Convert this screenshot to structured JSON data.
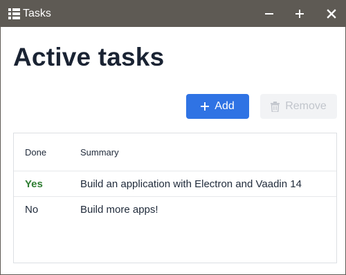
{
  "window": {
    "title": "Tasks",
    "icon": "list-icon",
    "controls": [
      "minimize-icon",
      "maximize-icon",
      "close-icon"
    ]
  },
  "page": {
    "title": "Active tasks"
  },
  "toolbar": {
    "add_label": "Add",
    "add_icon": "plus-icon",
    "remove_label": "Remove",
    "remove_icon": "trash-icon",
    "remove_disabled": true
  },
  "grid": {
    "columns": [
      "Done",
      "Summary"
    ],
    "rows": [
      {
        "done": "Yes",
        "summary": "Build an application with Electron and Vaadin 14"
      },
      {
        "done": "No",
        "summary": "Build more apps!"
      }
    ]
  },
  "colors": {
    "titlebar": "#5e5a54",
    "accent": "#2f73e4",
    "done_yes": "#2e7d32",
    "disabled_bg": "#f2f3f5",
    "disabled_text": "#c1c5cc"
  }
}
